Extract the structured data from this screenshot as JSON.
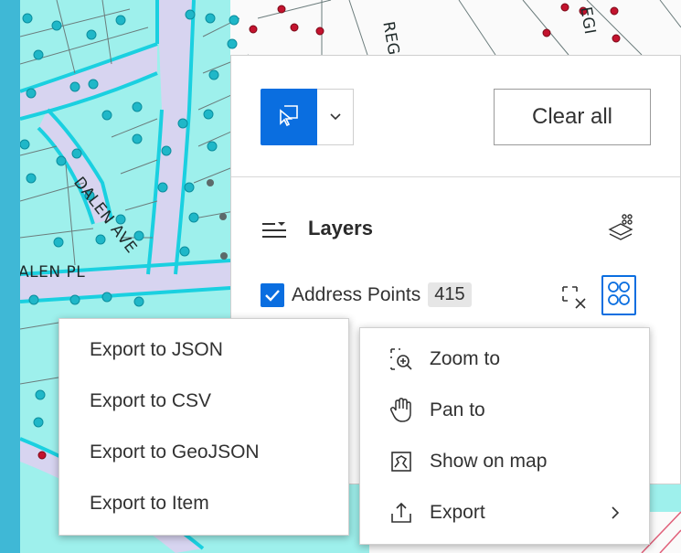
{
  "map": {
    "street_labels": [
      "DALEN AVE",
      "ALEN PL",
      "REG",
      "EGI"
    ]
  },
  "toolbar": {
    "select_tool_icon": "select-cursor-icon",
    "caret_icon": "chevron-down-icon",
    "clear_all_label": "Clear all"
  },
  "layers": {
    "title": "Layers",
    "items": [
      {
        "name": "Address Points",
        "count": "415",
        "checked": true
      }
    ]
  },
  "actions_menu": {
    "items": [
      {
        "label": "Zoom to",
        "icon": "zoom-to-icon"
      },
      {
        "label": "Pan to",
        "icon": "pan-hand-icon"
      },
      {
        "label": "Show on map",
        "icon": "show-on-map-icon"
      },
      {
        "label": "Export",
        "icon": "export-icon"
      }
    ]
  },
  "export_menu": {
    "items": [
      {
        "label": "Export to JSON"
      },
      {
        "label": "Export to CSV"
      },
      {
        "label": "Export to GeoJSON"
      },
      {
        "label": "Export to Item"
      }
    ]
  },
  "colors": {
    "accent": "#0a6ee0",
    "map_parcel_fill": "#9ef0ec",
    "map_border": "#3fb8d6",
    "point_cyan": "#17c6d6",
    "point_red": "#c3132e"
  }
}
